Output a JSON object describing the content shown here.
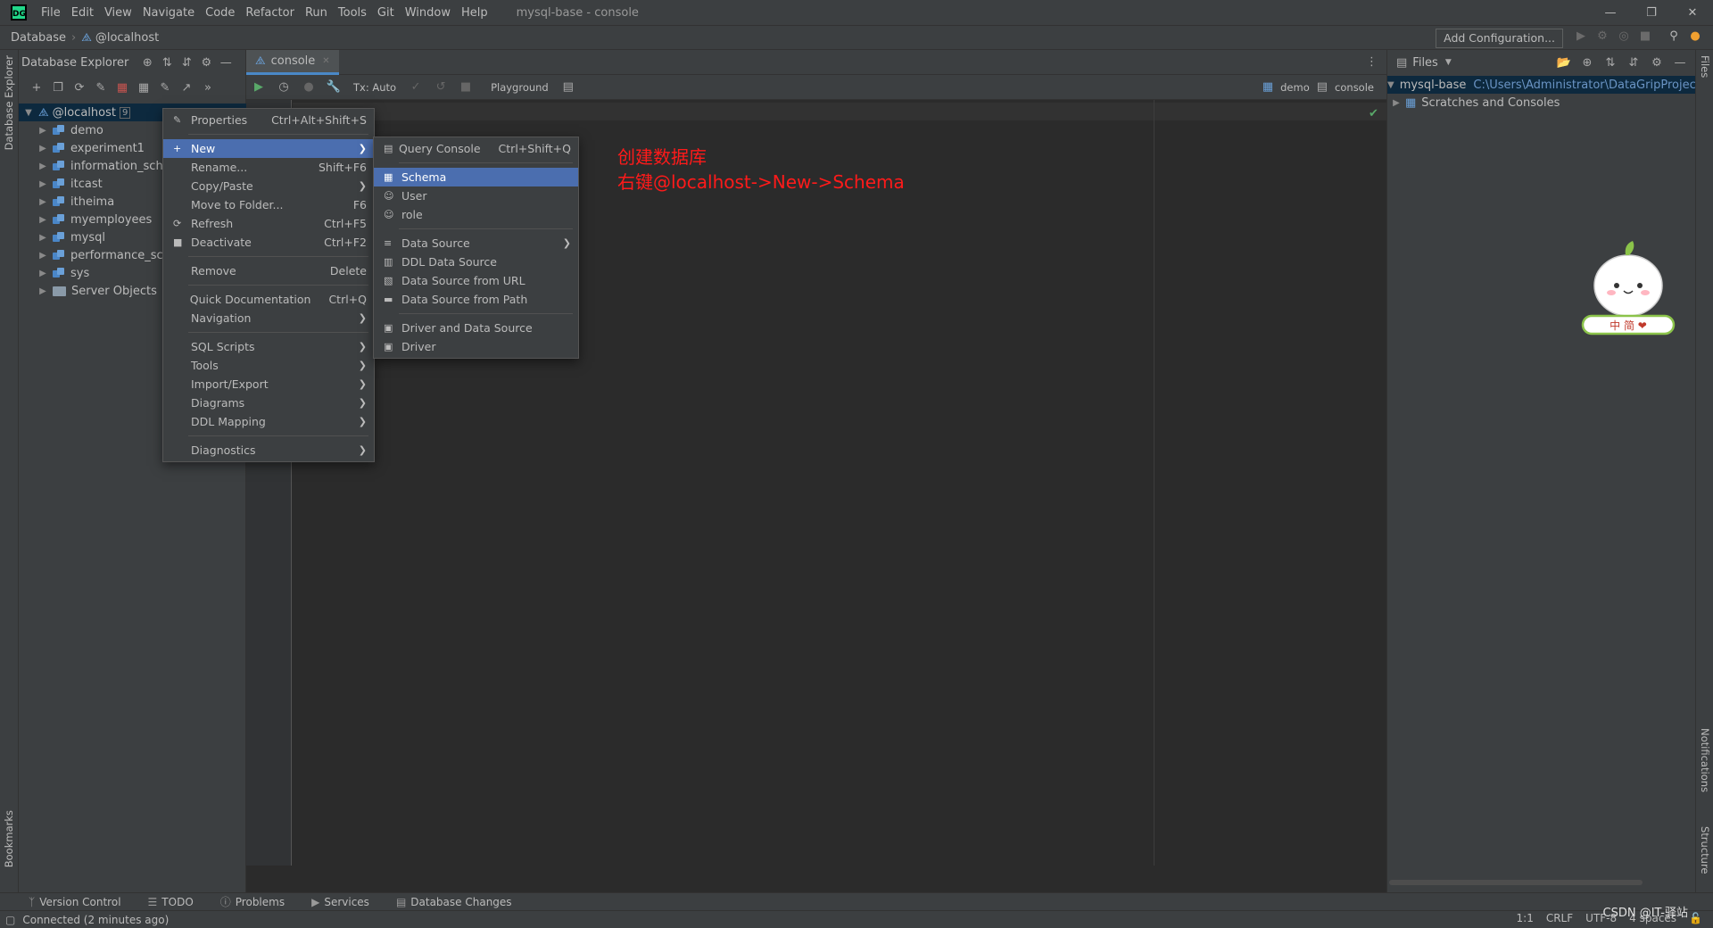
{
  "app": {
    "logo": "DG",
    "window_title": "mysql-base - console",
    "menu": [
      "File",
      "Edit",
      "View",
      "Navigate",
      "Code",
      "Refactor",
      "Run",
      "Tools",
      "Git",
      "Window",
      "Help"
    ]
  },
  "navbar": {
    "crumbs": [
      "Database",
      "@localhost"
    ],
    "add_config": "Add Configuration..."
  },
  "left_strip": {
    "database_explorer": "Database Explorer",
    "bookmarks": "Bookmarks"
  },
  "db_explorer": {
    "title": "Database Explorer",
    "root": {
      "label": "@localhost",
      "count": "9"
    },
    "items": [
      "demo",
      "experiment1",
      "information_schema",
      "itcast",
      "itheima",
      "myemployees",
      "mysql",
      "performance_schema",
      "sys",
      "Server Objects"
    ]
  },
  "editor": {
    "tab": "console",
    "toolbar": {
      "tx": "Tx: Auto",
      "playground": "Playground",
      "schema": "demo",
      "session": "console"
    }
  },
  "annotation": {
    "line1": "创建数据库",
    "line2": "右键@localhost->New->Schema"
  },
  "context_menu": [
    {
      "label": "Properties",
      "shortcut": "Ctrl+Alt+Shift+S",
      "icon": "properties-icon"
    },
    {
      "separator": true
    },
    {
      "label": "New",
      "submenu": true,
      "selected": true,
      "icon": "plus-icon"
    },
    {
      "label": "Rename...",
      "shortcut": "Shift+F6"
    },
    {
      "label": "Copy/Paste",
      "submenu": true
    },
    {
      "label": "Move to Folder...",
      "shortcut": "F6"
    },
    {
      "label": "Refresh",
      "shortcut": "Ctrl+F5",
      "icon": "refresh-icon"
    },
    {
      "label": "Deactivate",
      "shortcut": "Ctrl+F2",
      "icon": "deactivate-icon"
    },
    {
      "separator": true
    },
    {
      "label": "Remove",
      "shortcut": "Delete"
    },
    {
      "separator": true
    },
    {
      "label": "Quick Documentation",
      "shortcut": "Ctrl+Q"
    },
    {
      "label": "Navigation",
      "submenu": true
    },
    {
      "separator": true
    },
    {
      "label": "SQL Scripts",
      "submenu": true
    },
    {
      "label": "Tools",
      "submenu": true
    },
    {
      "label": "Import/Export",
      "submenu": true
    },
    {
      "label": "Diagrams",
      "submenu": true
    },
    {
      "label": "DDL Mapping",
      "submenu": true
    },
    {
      "separator": true
    },
    {
      "label": "Diagnostics",
      "submenu": true
    }
  ],
  "new_submenu": [
    {
      "label": "Query Console",
      "shortcut": "Ctrl+Shift+Q",
      "icon": "console-icon"
    },
    {
      "separator": true
    },
    {
      "label": "Schema",
      "selected": true,
      "icon": "schema-icon"
    },
    {
      "label": "User",
      "icon": "user-icon"
    },
    {
      "label": "role",
      "icon": "role-icon"
    },
    {
      "separator": true
    },
    {
      "label": "Data Source",
      "submenu": true,
      "icon": "datasource-icon"
    },
    {
      "label": "DDL Data Source",
      "icon": "ddl-icon"
    },
    {
      "label": "Data Source from URL",
      "icon": "url-icon"
    },
    {
      "label": "Data Source from Path",
      "icon": "folder-icon"
    },
    {
      "separator": true
    },
    {
      "label": "Driver and Data Source",
      "icon": "driver-icon"
    },
    {
      "label": "Driver",
      "icon": "driver-icon"
    }
  ],
  "files_panel": {
    "title": "Files",
    "project": "mysql-base",
    "project_path": "C:\\Users\\Administrator\\DataGripProjec",
    "scratches": "Scratches and Consoles"
  },
  "right_strip": {
    "files": "Files",
    "notifications": "Notifications",
    "structure": "Structure"
  },
  "mascot": {
    "caption": "中 简 ❤"
  },
  "bottom_tools": [
    "Version Control",
    "TODO",
    "Problems",
    "Services",
    "Database Changes"
  ],
  "status": {
    "left": "Connected (2 minutes ago)",
    "position": "1:1",
    "line_sep": "CRLF",
    "encoding": "UTF-8",
    "indent": "4 spaces",
    "watermark": "CSDN @IT-驿站"
  },
  "colors": {
    "accent": "#4b6eaf",
    "annotation": "#ff1a1a",
    "run": "#59a869"
  }
}
